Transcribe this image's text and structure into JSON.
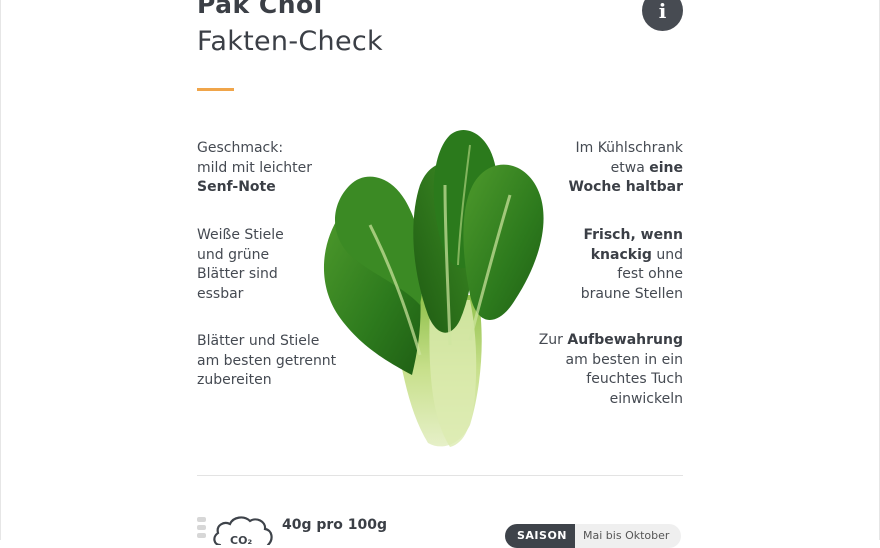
{
  "header": {
    "title": "Pak Choi",
    "subtitle": "Fakten-Check",
    "info_icon": "i"
  },
  "facts_left": [
    {
      "lines": [
        [
          "Geschmack:",
          ""
        ],
        [
          "mild mit leichter",
          ""
        ],
        [
          "",
          "Senf-Note"
        ]
      ]
    },
    {
      "lines": [
        [
          "Weiße Stiele",
          ""
        ],
        [
          "und grüne",
          ""
        ],
        [
          "Blätter sind",
          ""
        ],
        [
          "essbar",
          ""
        ]
      ]
    },
    {
      "lines": [
        [
          "Blätter und Stiele",
          ""
        ],
        [
          "am besten getrennt",
          ""
        ],
        [
          "zubereiten",
          ""
        ]
      ]
    }
  ],
  "facts_right": [
    {
      "lines": [
        [
          "Im Kühlschrank",
          ""
        ],
        [
          "etwa ",
          "eine"
        ],
        [
          "",
          "Woche haltbar"
        ]
      ]
    },
    {
      "lines": [
        [
          "",
          "Frisch, wenn"
        ],
        [
          "",
          "knackig"
        ],
        [
          "fest ohne",
          ""
        ],
        [
          "braune Stellen",
          ""
        ]
      ]
    },
    {
      "lines": [
        [
          "Zur ",
          "Aufbewahrung"
        ],
        [
          "am besten in ein",
          ""
        ],
        [
          "feuchtes Tuch",
          ""
        ],
        [
          "einwickeln",
          ""
        ]
      ]
    }
  ],
  "footer": {
    "co2_icon_label": "CO₂",
    "co2_value": "40g pro 100g",
    "season_label": "SAISON",
    "season_value": "Mai bis Oktober"
  },
  "colors": {
    "accent": "#f0a54a",
    "dark": "#3e434a",
    "leaf": "#2f7d22",
    "stem": "#c9e08f"
  },
  "icons": [
    "info-icon",
    "co2-cloud-icon",
    "pak-choi-image"
  ]
}
